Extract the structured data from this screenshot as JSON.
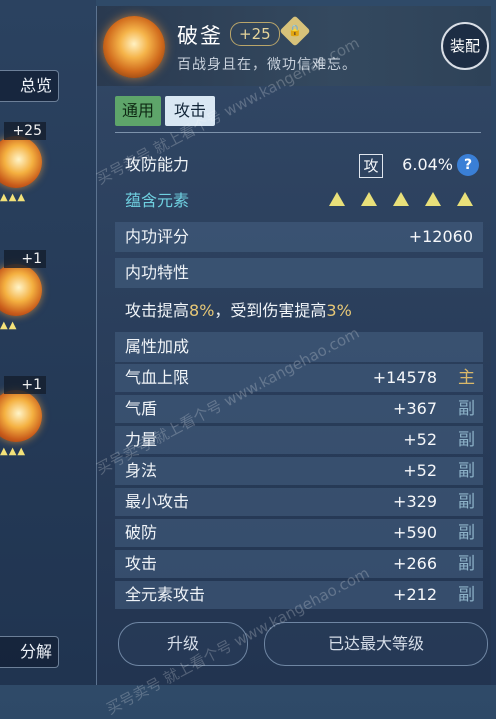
{
  "left": {
    "overview_label": "总览",
    "cards": [
      {
        "badge": "+25"
      },
      {
        "badge": "+1"
      },
      {
        "badge": "+1"
      }
    ],
    "decompose_label": "分解"
  },
  "item": {
    "name": "破釜",
    "level": "+25",
    "description": "百战身且在，微功信难忘。",
    "equip_label": "装配"
  },
  "tabs": {
    "general": "通用",
    "attack": "攻击"
  },
  "attack_defense": {
    "label": "攻防能力",
    "type_box": "攻",
    "value": "6.04%",
    "help": "?"
  },
  "element": {
    "label": "蕴含元素",
    "count": 5
  },
  "inner_score": {
    "label": "内功评分",
    "value": "+12060"
  },
  "inner_trait": {
    "label": "内功特性",
    "text_1": "攻击提高",
    "hl_1": "8%",
    "text_2": "，受到伤害提高",
    "hl_2": "3%"
  },
  "attributes": {
    "label": "属性加成",
    "rows": [
      {
        "name": "气血上限",
        "value": "+14578",
        "tag": "主"
      },
      {
        "name": "气盾",
        "value": "+367",
        "tag": "副"
      },
      {
        "name": "力量",
        "value": "+52",
        "tag": "副"
      },
      {
        "name": "身法",
        "value": "+52",
        "tag": "副"
      },
      {
        "name": "最小攻击",
        "value": "+329",
        "tag": "副"
      },
      {
        "name": "破防",
        "value": "+590",
        "tag": "副"
      },
      {
        "name": "攻击",
        "value": "+266",
        "tag": "副"
      },
      {
        "name": "全元素攻击",
        "value": "+212",
        "tag": "副"
      }
    ]
  },
  "buttons": {
    "upgrade": "升级",
    "max_level": "已达最大等级"
  },
  "watermark": {
    "line1": "买号卖号 就上看个号",
    "line2": "www.kangehao.com"
  },
  "colors": {
    "highlight": "#e7c877",
    "element": "#6fd0e0",
    "main_tag": "#d9b869"
  }
}
